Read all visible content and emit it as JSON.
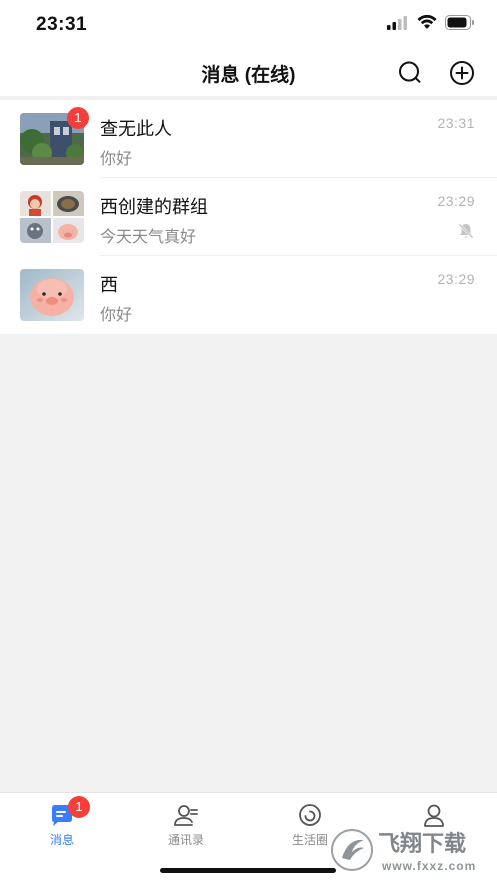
{
  "status_bar": {
    "time": "23:31"
  },
  "nav": {
    "title": "消息 (在线)"
  },
  "chats": [
    {
      "name": "查无此人",
      "preview": "你好",
      "time": "23:31",
      "badge": "1",
      "muted": false
    },
    {
      "name": "西创建的群组",
      "preview": "今天天气真好",
      "time": "23:29",
      "badge": "",
      "muted": true
    },
    {
      "name": "西",
      "preview": "你好",
      "time": "23:29",
      "badge": "",
      "muted": false
    }
  ],
  "tabs": [
    {
      "label": "消息",
      "icon": "chat-icon",
      "badge": "1",
      "active": true
    },
    {
      "label": "通讯录",
      "icon": "contacts-icon",
      "active": false
    },
    {
      "label": "生活圈",
      "icon": "moments-icon",
      "active": false
    },
    {
      "label": "",
      "icon": "profile-icon",
      "active": false
    }
  ],
  "watermark": {
    "text": "飞翔下载",
    "url_text": "www.fxxz.com"
  },
  "colors": {
    "accent": "#3a7cff",
    "badge": "#f43f3b"
  }
}
